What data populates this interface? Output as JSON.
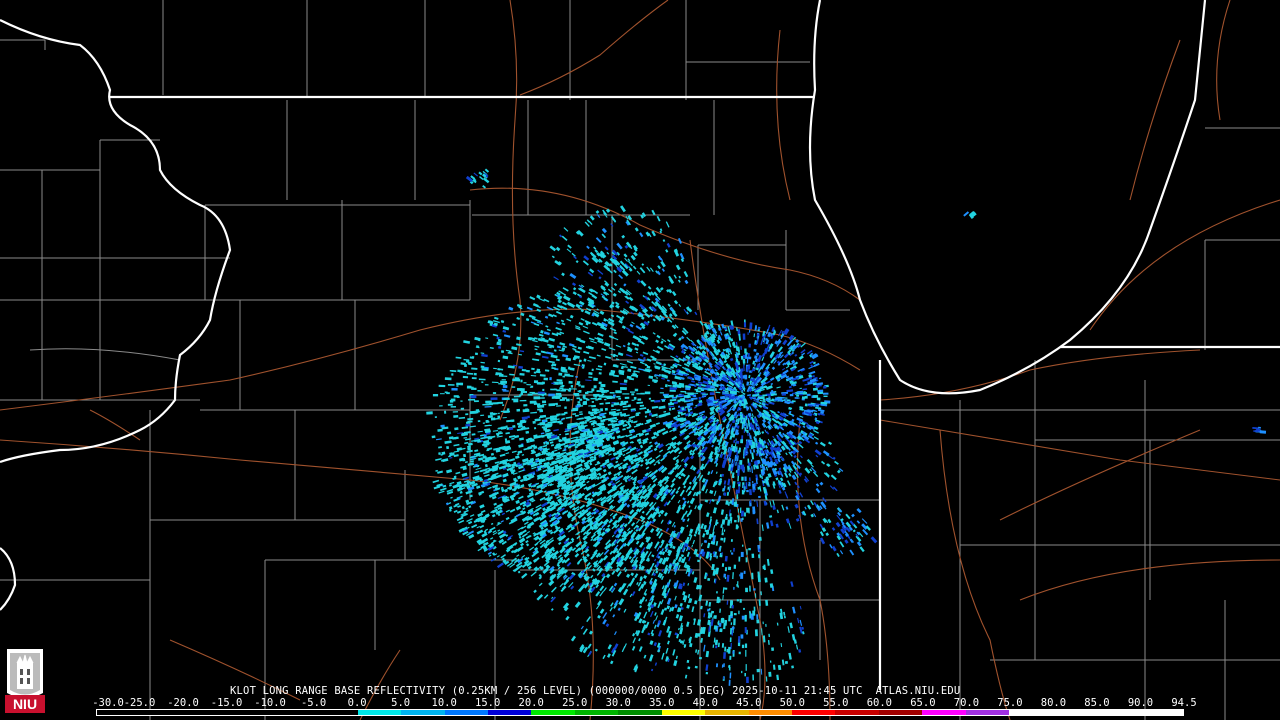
{
  "window": {
    "header_text": "KLOT LONG RANGE BASE REFLECTIVITY (0.25KM / 256 LEVEL) (000000/0000 0.5 DEG) 2025-10-11 21:45 UTC  ATLAS.NIU.EDU",
    "logo_text": "NIU"
  },
  "colorbar": {
    "labels": [
      "-30.0",
      "-25.0",
      "-20.0",
      "-15.0",
      "-10.0",
      "-5.0",
      "0.0",
      "5.0",
      "10.0",
      "15.0",
      "20.0",
      "25.0",
      "30.0",
      "35.0",
      "40.0",
      "45.0",
      "50.0",
      "55.0",
      "60.0",
      "65.0",
      "70.0",
      "75.0",
      "80.0",
      "85.0",
      "90.0",
      "94.5"
    ],
    "colors": [
      "#000000",
      "#000000",
      "#000000",
      "#000000",
      "#000000",
      "#000000",
      "#00e6e6",
      "#00b4f0",
      "#0078ff",
      "#0000d8",
      "#00e600",
      "#00b400",
      "#008c00",
      "#ffff00",
      "#e6b400",
      "#ff8c00",
      "#ff0000",
      "#c80000",
      "#a00000",
      "#ff00ff",
      "#a030e0",
      "#ffffff",
      "#ffffff",
      "#ffffff",
      "#ffffff"
    ]
  },
  "map_colors": {
    "state_border": "#ffffff",
    "county_line": "#8a8a8a",
    "highway": "#a0522d",
    "echo_light": "#22d3e0",
    "echo_medium": "#1e90ff",
    "echo_dark": "#1040d0"
  }
}
